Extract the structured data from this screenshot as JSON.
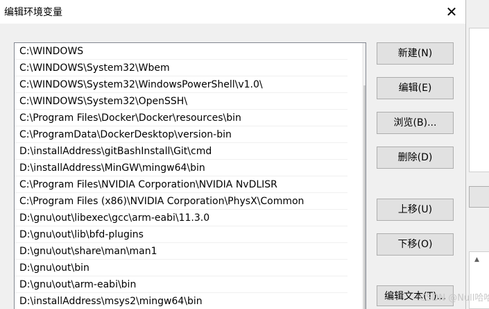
{
  "dialog": {
    "title": "编辑环境变量",
    "close_glyph": "✕"
  },
  "paths": [
    "C:\\WINDOWS",
    "C:\\WINDOWS\\System32\\Wbem",
    "C:\\WINDOWS\\System32\\WindowsPowerShell\\v1.0\\",
    "C:\\WINDOWS\\System32\\OpenSSH\\",
    "C:\\Program Files\\Docker\\Docker\\resources\\bin",
    "C:\\ProgramData\\DockerDesktop\\version-bin",
    "D:\\installAddress\\gitBashInstall\\Git\\cmd",
    "D:\\installAddress\\MinGW\\mingw64\\bin",
    "C:\\Program Files\\NVIDIA Corporation\\NVIDIA NvDLISR",
    "C:\\Program Files (x86)\\NVIDIA Corporation\\PhysX\\Common",
    "D:\\gnu\\out\\libexec\\gcc\\arm-eabi\\11.3.0",
    "D:\\gnu\\out\\lib\\bfd-plugins",
    "D:\\gnu\\out\\share\\man\\man1",
    "D:\\gnu\\out\\bin",
    "D:\\gnu\\out\\arm-eabi\\bin",
    "D:\\installAddress\\msys2\\mingw64\\bin"
  ],
  "buttons": {
    "new": "新建(N)",
    "edit": "编辑(E)",
    "browse": "浏览(B)...",
    "delete": "删除(D)",
    "move_up": "上移(U)",
    "move_down": "下移(O)",
    "edit_text": "编辑文本(T)..."
  },
  "scrollbar": {
    "up_glyph": "▲"
  },
  "watermark": "CSDN @Null哈哈",
  "background_window": {
    "scroll_glyph": "▲"
  }
}
